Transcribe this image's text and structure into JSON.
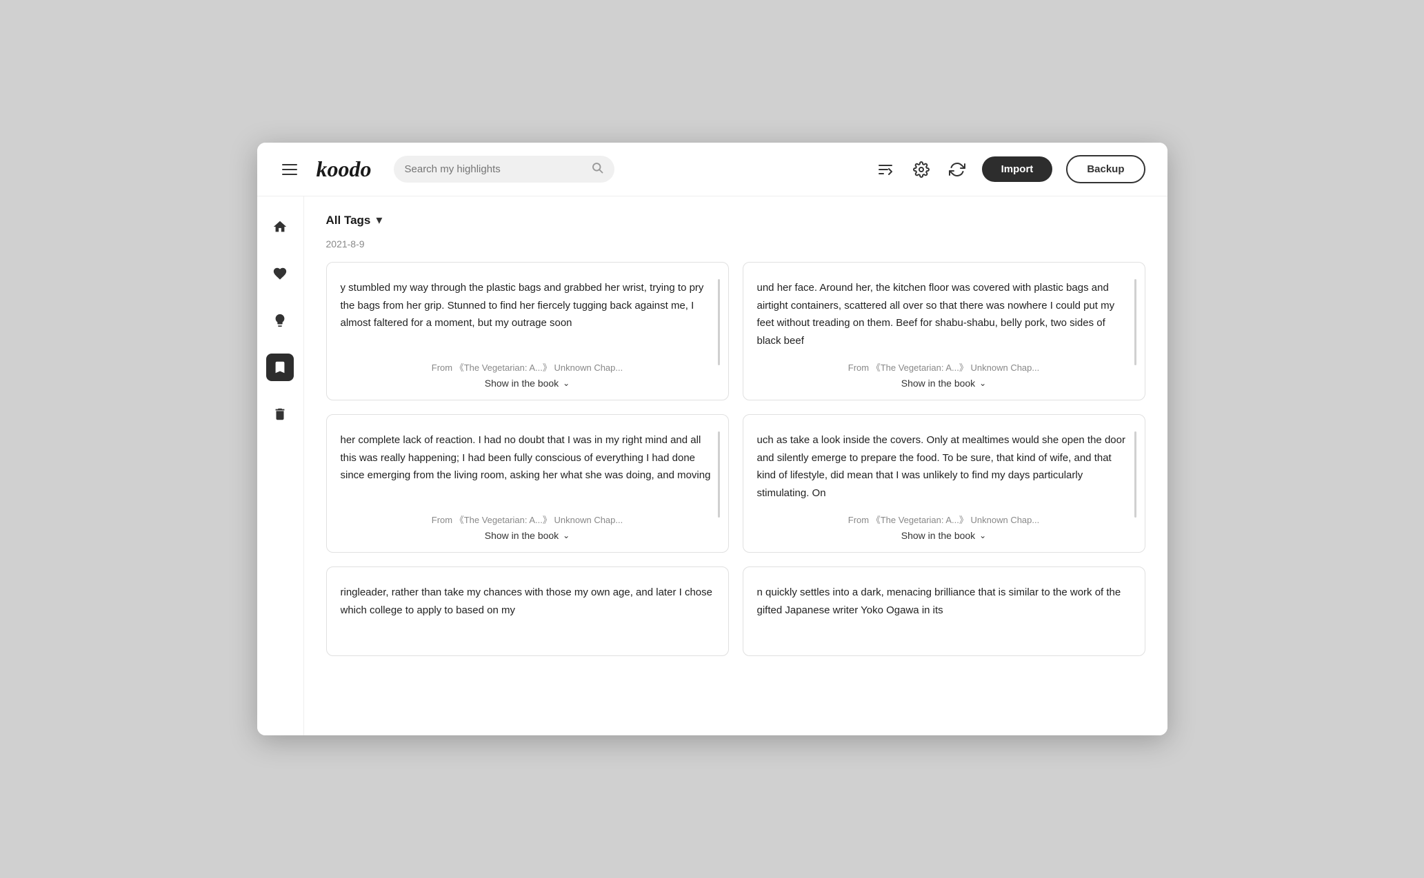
{
  "header": {
    "logo": "koodo",
    "search_placeholder": "Search my highlights",
    "import_label": "Import",
    "backup_label": "Backup"
  },
  "sidebar": {
    "items": [
      {
        "id": "home",
        "label": "Home",
        "active": false
      },
      {
        "id": "favorites",
        "label": "Favorites",
        "active": false
      },
      {
        "id": "ideas",
        "label": "Ideas",
        "active": false
      },
      {
        "id": "highlights",
        "label": "Highlights",
        "active": true
      },
      {
        "id": "trash",
        "label": "Trash",
        "active": false
      }
    ]
  },
  "filter": {
    "label": "All Tags",
    "chevron": "▾"
  },
  "date_group": "2021-8-9",
  "highlights": [
    {
      "id": "h1",
      "text": "y stumbled my way through the plastic bags and grabbed her wrist, trying to pry the bags from her grip. Stunned to find her fiercely tugging back against me, I almost faltered for a moment, but my outrage soon",
      "source": "From 《The Vegetarian: A...》 Unknown Chap...",
      "show_label": "Show in the book",
      "has_scroll": true
    },
    {
      "id": "h2",
      "text": "und her face. Around her, the kitchen floor was covered with plastic bags and airtight containers, scattered all over so that there was nowhere I could put my feet without treading on them. Beef for shabu-shabu, belly pork, two sides of black beef",
      "source": "From 《The Vegetarian: A...》 Unknown Chap...",
      "show_label": "Show in the book",
      "has_scroll": true
    },
    {
      "id": "h3",
      "text": "her complete lack of reaction. I had no doubt that I was in my right mind and all this was really happening; I had been fully conscious of everything I had done since emerging from the living room, asking her what she was doing, and moving",
      "source": "From 《The Vegetarian: A...》 Unknown Chap...",
      "show_label": "Show in the book",
      "has_scroll": true
    },
    {
      "id": "h4",
      "text": "uch as take a look inside the covers. Only at mealtimes would she open the door and silently emerge to prepare the food. To be sure, that kind of wife, and that kind of lifestyle, did mean that I was unlikely to find my days particularly stimulating. On",
      "source": "From 《The Vegetarian: A...》 Unknown Chap...",
      "show_label": "Show in the book",
      "has_scroll": true
    },
    {
      "id": "h5",
      "text": "ringleader, rather than take my chances with those my own age, and later I chose which college to apply to based on my",
      "source": "",
      "show_label": "",
      "has_scroll": false,
      "partial": true
    },
    {
      "id": "h6",
      "text": "n quickly settles into a dark, menacing brilliance that is similar to the work of the gifted Japanese writer Yoko Ogawa in its",
      "source": "",
      "show_label": "",
      "has_scroll": false,
      "partial": true
    }
  ]
}
